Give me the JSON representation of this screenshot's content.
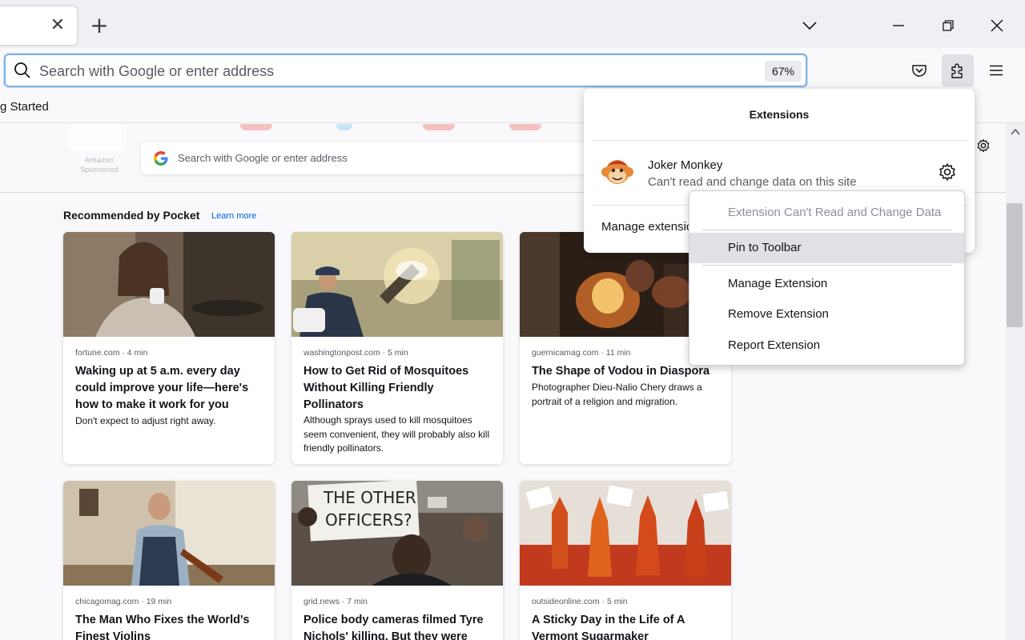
{
  "tabbar": {
    "tab_close": "✕",
    "new_tab": "+"
  },
  "navbar": {
    "search_placeholder": "Search with Google or enter address",
    "zoom": "67%"
  },
  "bookmarks": {
    "item_label": "g Started"
  },
  "newtab": {
    "topsite_label": "Amazon",
    "topsite_sponsored": "Sponsored",
    "search_placeholder": "Search with Google or enter address",
    "recommended_title": "Recommended by Pocket",
    "learn_more": "Learn more",
    "cards": [
      {
        "source": "fortune.com · 4 min",
        "title": "Waking up at 5 a.m. every day could improve your life—here's how to make it work for you",
        "excerpt": "Don't expect to adjust right away."
      },
      {
        "source": "washingtonpost.com · 5 min",
        "title": "How to Get Rid of Mosquitoes Without Killing Friendly Pollinators",
        "excerpt": "Although sprays used to kill mosquitoes seem convenient, they will probably also kill friendly pollinators."
      },
      {
        "source": "guernicamag.com · 11 min",
        "title": "The Shape of Vodou in Diaspora",
        "excerpt": "Photographer Dieu-Nalio Chery draws a portrait of a religion and migration."
      },
      {
        "source": "chicagomag.com · 19 min",
        "title": "The Man Who Fixes the World's Finest Violins",
        "excerpt": ""
      },
      {
        "source": "grid.news · 7 min",
        "title": "Police body cameras filmed Tyre Nichols' killing. But they were",
        "excerpt": ""
      },
      {
        "source": "outsideonline.com · 5 min",
        "title": "A Sticky Day in the Life of A Vermont Sugarmaker",
        "excerpt": ""
      }
    ],
    "protest_sign": [
      "THE OTHER",
      "OFFICERS?"
    ]
  },
  "extensions_panel": {
    "title": "Extensions",
    "extension_name": "Joker Monkey",
    "extension_permission": "Can't read and change data on this site",
    "manage_label": "Manage extensions"
  },
  "context_menu": {
    "items": [
      "Extension Can't Read and Change Data",
      "Pin to Toolbar",
      "Manage Extension",
      "Remove Extension",
      "Report Extension"
    ]
  },
  "colors": {
    "accent": "#0061e0",
    "focus_ring": "#7fb3e6",
    "menu_hover": "#e0e0e6"
  }
}
